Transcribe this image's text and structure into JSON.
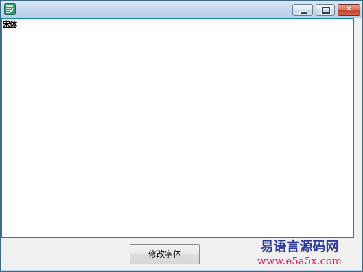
{
  "window": {
    "icon": "e-language-app-icon",
    "controls": {
      "minimize": "minimize-icon",
      "maximize": "maximize-icon",
      "close_glyph": "✕"
    }
  },
  "editor": {
    "text": "宋体"
  },
  "toolbar": {
    "change_font_label": "修改字体"
  },
  "watermark": {
    "title": "易语言源码网",
    "url": "www.e5a5x.com"
  },
  "colors": {
    "editor_border": "#0f8c92",
    "watermark_title": "#2d3a9b",
    "watermark_url": "#e0206a",
    "close_button": "#c4402a"
  }
}
